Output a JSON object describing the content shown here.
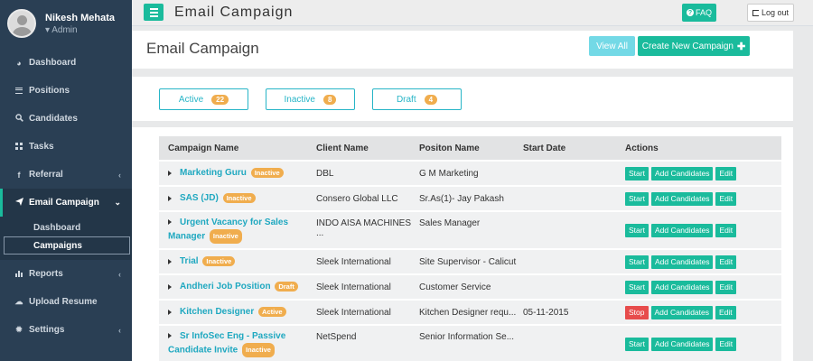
{
  "profile": {
    "name": "Nikesh Mehata",
    "role": "Admin"
  },
  "sidebar": {
    "items": [
      {
        "label": "Dashboard",
        "icon": "dashboard-icon"
      },
      {
        "label": "Positions",
        "icon": "list-icon"
      },
      {
        "label": "Candidates",
        "icon": "search-icon"
      },
      {
        "label": "Tasks",
        "icon": "calendar-icon"
      },
      {
        "label": "Referral",
        "icon": "facebook-icon"
      },
      {
        "label": "Email Campaign",
        "icon": "mail-send-icon"
      },
      {
        "label": "Reports",
        "icon": "bar-chart-icon"
      },
      {
        "label": "Upload Resume",
        "icon": "cloud-upload-icon"
      },
      {
        "label": "Settings",
        "icon": "gear-icon"
      }
    ],
    "submenu": [
      {
        "label": "Dashboard"
      },
      {
        "label": "Campaigns"
      }
    ]
  },
  "topbar": {
    "title": "Email Campaign",
    "faq_label": "FAQ",
    "logout_label": "Log out"
  },
  "header": {
    "title": "Email Campaign",
    "view_all_label": "View All",
    "create_label": "Create New Campaign"
  },
  "tabs": [
    {
      "label": "Active",
      "count": "22"
    },
    {
      "label": "Inactive",
      "count": "8"
    },
    {
      "label": "Draft",
      "count": "4"
    }
  ],
  "table": {
    "columns": [
      "Campaign Name",
      "Client Name",
      "Positon Name",
      "Start Date",
      "Actions"
    ],
    "rows": [
      {
        "name": "Marketing Guru",
        "status": "Inactive",
        "client": "DBL",
        "position": "G M Marketing",
        "start_date": "",
        "action": "Start"
      },
      {
        "name": "SAS (JD)",
        "status": "Inactive",
        "client": "Consero Global LLC",
        "position": "Sr.As(1)- Jay Pakash",
        "start_date": "",
        "action": "Start"
      },
      {
        "name": "Urgent Vacancy for Sales",
        "name2": "Manager",
        "status": "Inactive",
        "client": "INDO AISA MACHINES ...",
        "position": "Sales Manager",
        "start_date": "",
        "action": "Start"
      },
      {
        "name": "Trial",
        "status": "Inactive",
        "client": "Sleek International",
        "position": "Site Supervisor - Calicut",
        "start_date": "",
        "action": "Start"
      },
      {
        "name": "Andheri Job Position",
        "status": "Draft",
        "client": "Sleek International",
        "position": "Customer Service",
        "start_date": "",
        "action": "Start"
      },
      {
        "name": "Kitchen Designer",
        "status": "Active",
        "client": "Sleek International",
        "position": "Kitchen Designer requ...",
        "start_date": "05-11-2015",
        "action": "Stop"
      },
      {
        "name": "Sr InfoSec Eng - Passive",
        "name2": "Candidate Invite",
        "status": "Inactive",
        "client": "NetSpend",
        "position": "Senior Information Se...",
        "start_date": "",
        "action": "Start"
      }
    ],
    "add_label": "Add Candidates",
    "edit_label": "Edit"
  },
  "colors": {
    "accent": "#1abb9c",
    "sidebar_bg": "#2a3f54",
    "badge": "#f0ad4e",
    "stop": "#e74c4c",
    "link": "#1fa8c0"
  }
}
